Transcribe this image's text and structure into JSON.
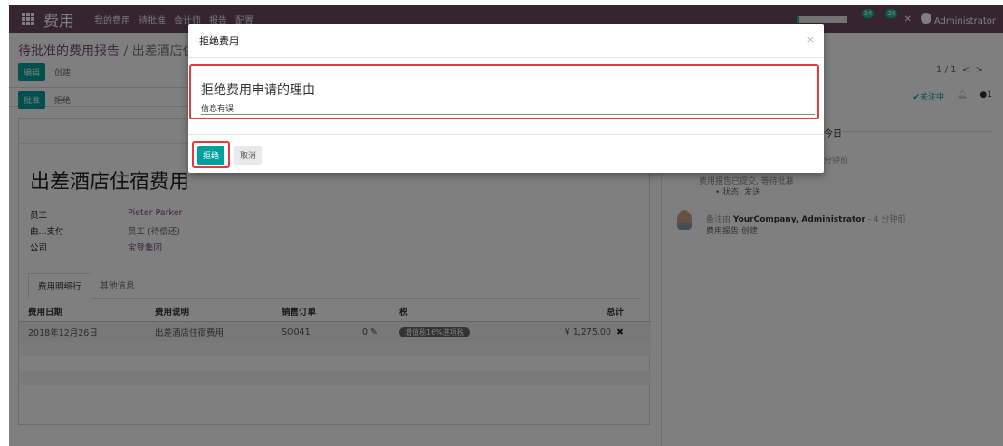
{
  "topbar": {
    "app_name": "费用",
    "menu": [
      "我的费用",
      "待批准",
      "会计师",
      "报告",
      "配置"
    ],
    "notif_chat_count": "24",
    "notif_activity_count": "28",
    "user": "Administrator"
  },
  "breadcrumb": {
    "parent": "待批准的费用报告",
    "sep": " / ",
    "current": "出差酒店住"
  },
  "control_panel": {
    "edit_label": "编辑",
    "create_label": "创建",
    "pager": "1 / 1"
  },
  "status_bar": {
    "approve_label": "批准",
    "refuse_label": "拒绝"
  },
  "record": {
    "title": "出差酒店住宿费用",
    "fields": [
      {
        "label": "员工",
        "value": "Pieter Parker"
      },
      {
        "label": "由...支付",
        "value": "员工 (待偿还)"
      },
      {
        "label": "公司",
        "value": "宝登集团"
      }
    ],
    "tabs": [
      "费用明细行",
      "其他信息"
    ],
    "columns": [
      "费用日期",
      "费用说明",
      "销售订单",
      "税",
      "总计"
    ],
    "rows": [
      {
        "date": "2018年12月26日",
        "desc": "出差酒店住宿费用",
        "so": "SO041",
        "qty": "0",
        "tax": "增值税16%进项税",
        "total": "¥ 1,275.00"
      }
    ]
  },
  "chatter": {
    "follow_label": "✔关注中",
    "followers": "1",
    "today": "今日",
    "msg1_time": "分钟前",
    "msg1_text": "费用报告已提交, 等待批准",
    "msg1_bullet": "• 状态: 发送",
    "msg2_prefix": "备注由",
    "msg2_author": "YourCompany, Administrator",
    "msg2_time": "- 4 分钟前",
    "msg2_body": "费用报告 创建"
  },
  "modal": {
    "title": "拒绝费用",
    "close": "×",
    "reason_label": "拒绝费用申请的理由",
    "reason_value": "信息有误",
    "reject_label": "拒绝",
    "cancel_label": "取消"
  },
  "colors": {
    "primary": "#00a09d",
    "nav": "#6b4a5e",
    "highlight": "#e23c3c"
  }
}
